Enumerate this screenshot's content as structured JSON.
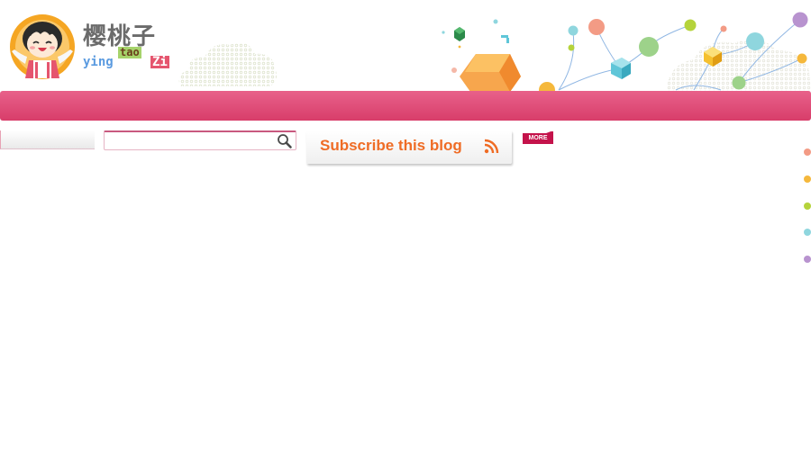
{
  "logo": {
    "title": "樱桃子",
    "sub_ying": "ying",
    "sub_tao": "tao",
    "sub_zi": "Zi"
  },
  "colors": {
    "nav_top": "#e8618a",
    "nav_bottom": "#d83d6a",
    "subscribe_text": "#ef6c25",
    "more_bg": "#c4134b"
  },
  "search": {
    "value": "",
    "placeholder": "",
    "icon": "magnifier-icon"
  },
  "subscribe": {
    "label": "Subscribe this blog",
    "icon": "rss-icon"
  },
  "more": {
    "label": "MORE"
  },
  "side_dots": [
    "#f39b85",
    "#f5b83c",
    "#b5d33b",
    "#8fd6de",
    "#b893cf"
  ]
}
